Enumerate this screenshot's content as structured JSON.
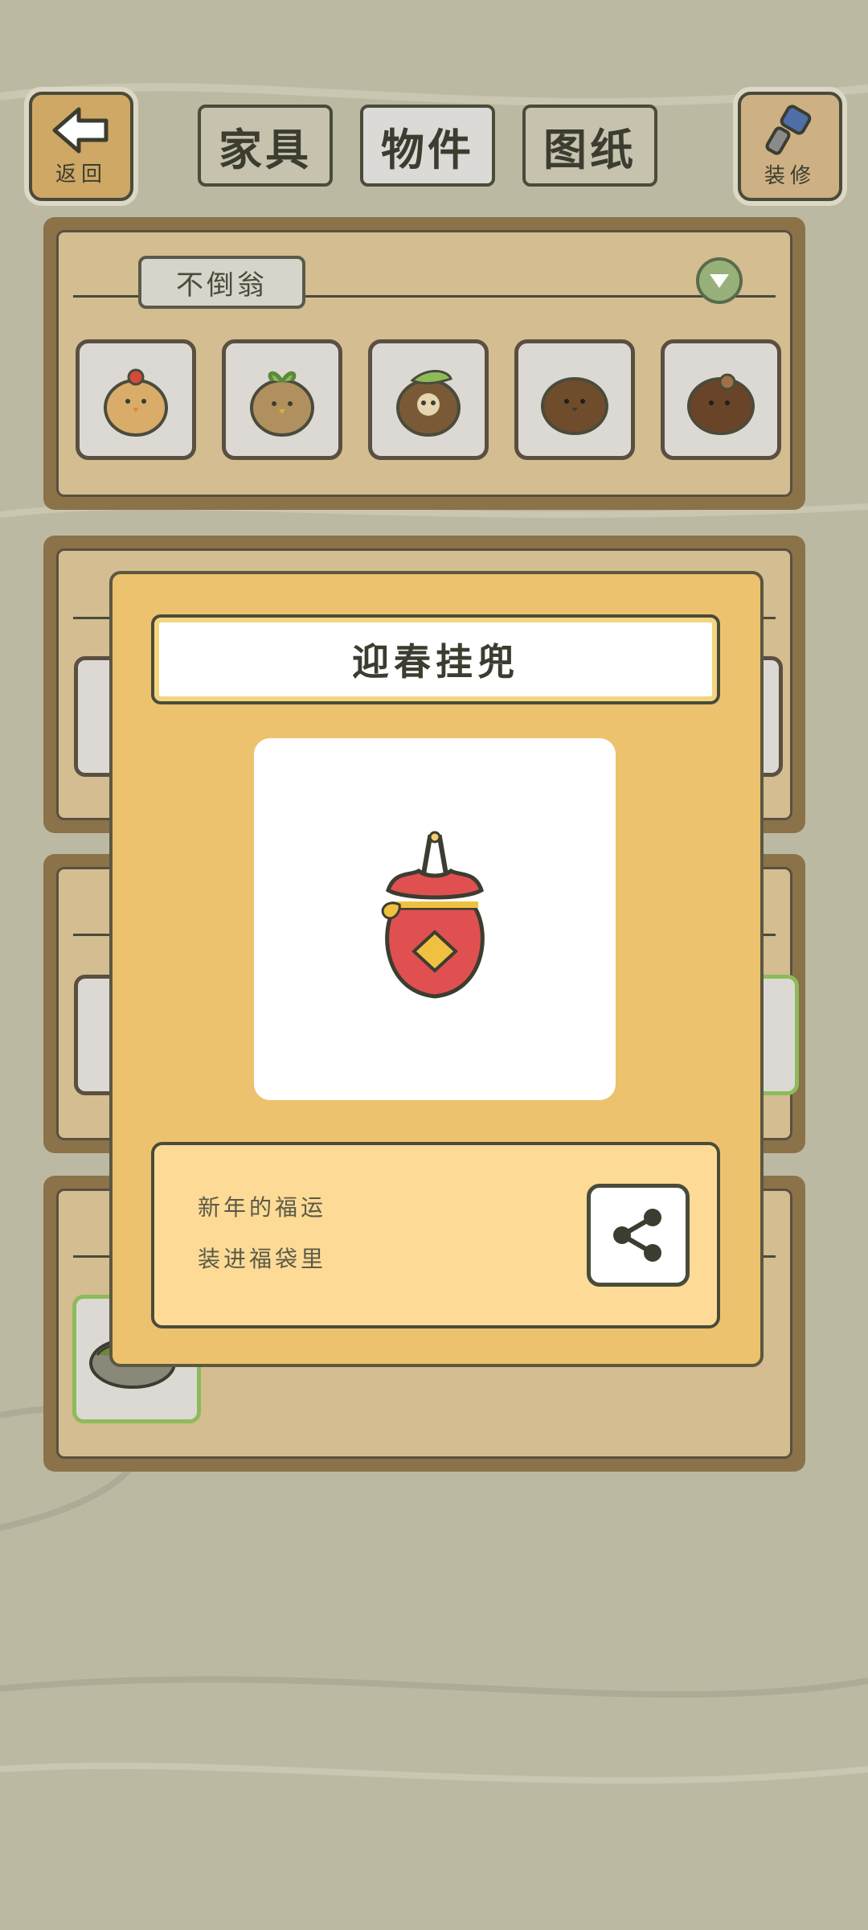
{
  "header": {
    "back_label": "返回",
    "decor_label": "装修",
    "tabs": [
      {
        "label": "家具",
        "active": false
      },
      {
        "label": "物件",
        "active": true
      },
      {
        "label": "图纸",
        "active": false
      }
    ]
  },
  "category": {
    "name": "不倒翁",
    "items": [
      "cherry-daruma-icon",
      "sprout-daruma-icon",
      "leaf-daruma-icon",
      "brown-daruma-icon",
      "dark-daruma-icon"
    ]
  },
  "modal": {
    "title": "迎春挂兜",
    "image_icon": "lucky-bag-icon",
    "description": [
      "新年的福运",
      "装进福袋里"
    ],
    "share_icon": "share-icon"
  },
  "colors": {
    "background": "#bcb9a3",
    "modal_bg": "#ecc26f",
    "desc_bg": "#fddb96",
    "accent_green": "#98b17a"
  }
}
